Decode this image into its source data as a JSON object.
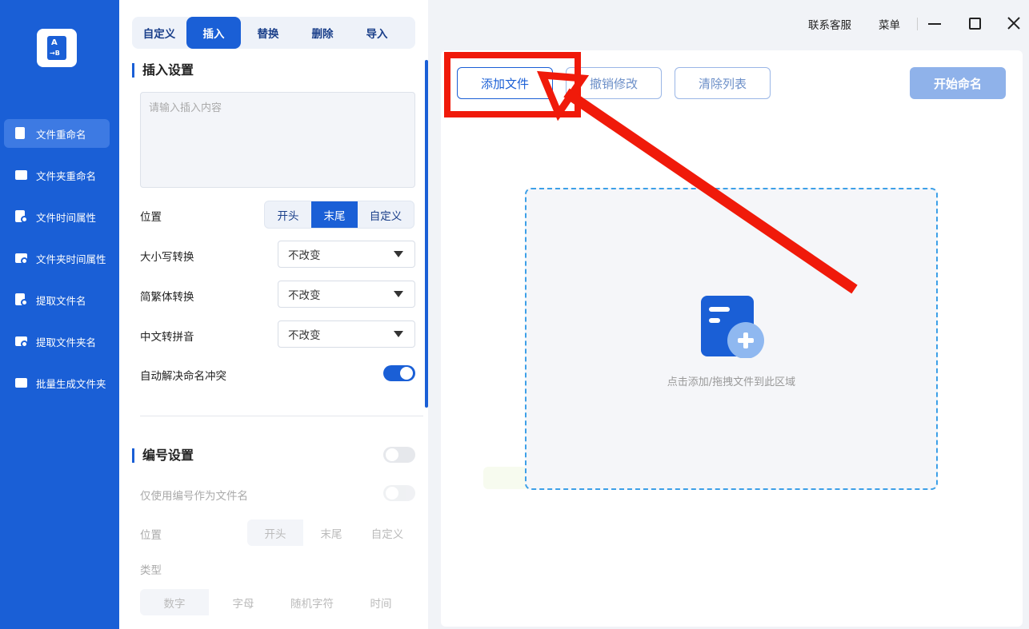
{
  "sidebar": {
    "items": [
      {
        "label": "文件重命名"
      },
      {
        "label": "文件夹重命名"
      },
      {
        "label": "文件时间属性"
      },
      {
        "label": "文件夹时间属性"
      },
      {
        "label": "提取文件名"
      },
      {
        "label": "提取文件夹名"
      },
      {
        "label": "批量生成文件夹"
      }
    ]
  },
  "tabs": [
    {
      "label": "自定义"
    },
    {
      "label": "插入"
    },
    {
      "label": "替换"
    },
    {
      "label": "删除"
    },
    {
      "label": "导入"
    }
  ],
  "insert_settings": {
    "title": "插入设置",
    "content_placeholder": "请输入插入内容",
    "position_label": "位置",
    "position_options": [
      "开头",
      "末尾",
      "自定义"
    ],
    "position_selected": "末尾",
    "case_label": "大小写转换",
    "case_value": "不改变",
    "trad_label": "简繁体转换",
    "trad_value": "不改变",
    "pinyin_label": "中文转拼音",
    "pinyin_value": "不改变",
    "conflict_label": "自动解决命名冲突",
    "conflict_on": true
  },
  "number_settings": {
    "title": "编号设置",
    "enabled": false,
    "only_number_label": "仅使用编号作为文件名",
    "position_label": "位置",
    "position_options": [
      "开头",
      "末尾",
      "自定义"
    ],
    "type_label": "类型",
    "type_options": [
      "数字",
      "字母",
      "随机字符",
      "时间"
    ]
  },
  "topbar": {
    "support": "联系客服",
    "menu": "菜单"
  },
  "toolbar": {
    "add_file": "添加文件",
    "undo": "撤销修改",
    "clear": "清除列表",
    "start": "开始命名"
  },
  "dropzone": {
    "hint": "点击添加/拖拽文件到此区域"
  },
  "colors": {
    "primary": "#1a5fd6",
    "annotation_red": "#f01a0a",
    "dropzone_border": "#3da0e8"
  }
}
